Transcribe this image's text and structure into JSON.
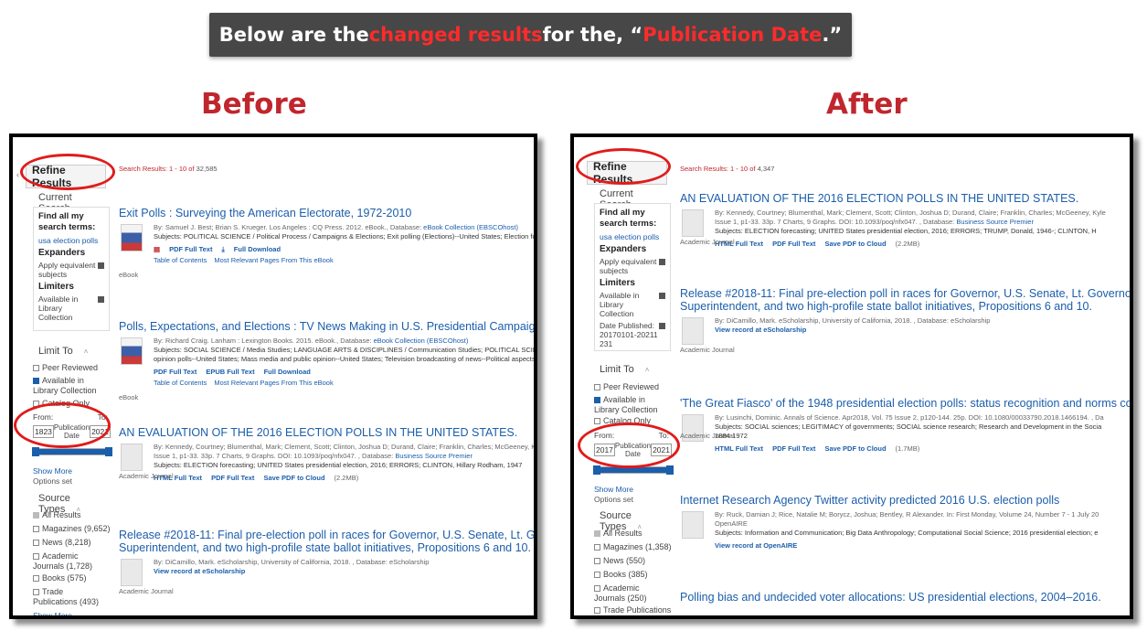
{
  "banner": {
    "pre": "Below are the ",
    "red1": "changed results",
    "mid": " for the, “",
    "red2": "Publication Date",
    "post": ".”"
  },
  "headings": {
    "before": "Before",
    "after": "After"
  },
  "sidebar_common": {
    "refine": "Refine Results",
    "current_search": "Current Search",
    "find_all": "Find all my search terms:",
    "query": "usa election polls",
    "expanders": "Expanders",
    "apply_equiv": "Apply equivalent subjects",
    "limiters": "Limiters",
    "available": "Available in Library Collection",
    "limit_to": "Limit To",
    "peer": "Peer Reviewed",
    "avail_lib": "Available in Library Collection",
    "catalog": "Catalog Only",
    "from": "From:",
    "to": "To:",
    "pub_date": "Publication Date",
    "show_more": "Show More",
    "options_set": "Options set",
    "source_types": "Source Types"
  },
  "before": {
    "count_prefix": "Search Results: 1 - 10 of ",
    "count_total": "32,585",
    "from_year": "1823",
    "to_year": "2021",
    "slider_fill": 1.0,
    "sources": [
      "All Results",
      "Magazines (9,652)",
      "News (8,218)",
      "Academic Journals (1,728)",
      "Books (575)",
      "Trade Publications (493)"
    ],
    "show_more2": "Show More",
    "results": [
      {
        "num": "1.",
        "title": "Exit Polls : Surveying the American Electorate, 1972-2010",
        "meta": "By: Samuel J. Best; Brian S. Krueger. Los Angeles : CQ Press. 2012. eBook., Database: ",
        "db": "eBook Collection (EBSCOhost)",
        "subjects": "Subjects: POLITICAL SCIENCE / Political Process / Campaigns & Elections; Exit polling (Elections)--United States; Election forecasting--United",
        "type": "eBook",
        "a1": "PDF Full Text",
        "a2": "Full Download",
        "l1": "Table of Contents",
        "l2": "Most Relevant Pages From This eBook"
      },
      {
        "num": "2.",
        "title": "Polls, Expectations, and Elections : TV News Making in U.S. Presidential Campaigns",
        "meta": "By: Richard Craig. Lanham : Lexington Books. 2015. eBook., Database: ",
        "db": "eBook Collection (EBSCOhost)",
        "subjects": "Subjects: SOCIAL SCIENCE / Media Studies; LANGUAGE ARTS & DISCIPLINES / Communication Studies; POLITICAL SCIENCE / American Gov",
        "subjects2": "opinion polls--United States; Mass media and public opinion--United States; Television broadcasting of news--Political aspects--United States; Te",
        "type": "eBook",
        "a1": "PDF Full Text",
        "a2": "EPUB Full Text",
        "a3": "Full Download",
        "l1": "Table of Contents",
        "l2": "Most Relevant Pages From This eBook"
      },
      {
        "num": "3.",
        "title": "AN EVALUATION OF THE 2016 ELECTION POLLS IN THE UNITED STATES.",
        "meta": "By: Kennedy, Courtney; Blumenthal, Mark; Clement, Scott; Clinton, Joshua D; Durand, Claire; Franklin, Charles; McGeeney, Kyley; Miringoff, Lee; C",
        "meta2": "Issue 1, p1-33. 33p. 7 Charts, 9 Graphs. DOI: 10.1093/poq/nfx047. , Database: ",
        "db": "Business Source Premier",
        "subjects": "Subjects: ELECTION forecasting; UNITED States presidential election, 2016; ERRORS; CLINTON, Hillary Rodham, 1947",
        "type": "Academic Journal",
        "a1": "HTML Full Text",
        "a2": "PDF Full Text",
        "a3": "Save PDF to Cloud",
        "size": "(2.2MB)"
      },
      {
        "num": "4.",
        "title": "Release #2018-11: Final pre-election poll in races for Governor, U.S. Senate, Lt. Governor, Insurance C",
        "title2": "Superintendent, and two high-profile state ballot initiatives, Propositions 6 and 10.",
        "meta": "By: DiCamillo, Mark. eScholarship, University of California, 2018. , Database: eScholarship",
        "link": "View record at eScholarship",
        "type": "Academic Journal"
      }
    ]
  },
  "after": {
    "count_prefix": "Search Results: 1 - 10 of ",
    "count_total": "4,347",
    "date_published": "Date Published:",
    "date_range": "20170101-20211231",
    "from_year": "2017",
    "to_year": "2021",
    "slider_fill": 1.0,
    "sources": [
      "All Results",
      "Magazines (1,358)",
      "News (550)",
      "Books (385)",
      "Academic Journals (250)",
      "Trade Publications"
    ],
    "results": [
      {
        "num": "1.",
        "title": "AN EVALUATION OF THE 2016 ELECTION POLLS IN THE UNITED STATES.",
        "meta": "By: Kennedy, Courtney; Blumenthal, Mark; Clement, Scott; Clinton, Joshua D; Durand, Claire; Franklin, Charles; McGeeney, Kyle",
        "meta2": "Issue 1, p1-33. 33p. 7 Charts, 9 Graphs. DOI: 10.1093/poq/nfx047. , Database: ",
        "db": "Business Source Premier",
        "subjects": "Subjects: ELECTION forecasting; UNITED States presidential election, 2016; ERRORS; TRUMP, Donald, 1946-; CLINTON, H",
        "type": "Academic Journal",
        "a1": "HTML Full Text",
        "a2": "PDF Full Text",
        "a3": "Save PDF to Cloud",
        "size": "(2.2MB)"
      },
      {
        "num": "2.",
        "title": "Release #2018-11: Final pre-election poll in races for Governor, U.S. Senate, Lt. Governor",
        "title2": "Superintendent, and two high-profile state ballot initiatives, Propositions 6 and 10.",
        "meta": "By: DiCamillo, Mark. eScholarship, University of California, 2018. , Database: eScholarship",
        "link": "View record at eScholarship",
        "type": "Academic Journal"
      },
      {
        "num": "3.",
        "title": "'The Great Fiasco' of the 1948 presidential election polls: status recognition and norms co",
        "meta": "By: Lusinchi, Dominic. Annals of Science. Apr2018, Vol. 75 Issue 2, p120-144. 25p. DOI: 10.1080/00033790.2018.1466194. , Da",
        "subjects": "Subjects: SOCIAL sciences; LEGITIMACY of governments; SOCIAL science research; Research and Development in the Socia",
        "subjects2": "1884-1972",
        "type": "Academic Journal",
        "a1": "HTML Full Text",
        "a2": "PDF Full Text",
        "a3": "Save PDF to Cloud",
        "size": "(1.7MB)"
      },
      {
        "num": "4.",
        "title": "Internet Research Agency Twitter activity predicted 2016 U.S. election polls",
        "meta": "By: Ruck, Damian J; Rice, Natalie M; Borycz, Joshua; Bentley, R Alexander. In: First Monday, Volume 24, Number 7 - 1 July 20",
        "meta2": "OpenAIRE",
        "subjects": "Subjects: Information and Communication; Big Data Anthropology; Computational Social Science; 2016 presidential election; e",
        "link": "View record at OpenAIRE"
      },
      {
        "num": "5.",
        "title": "Polling bias and undecided voter allocations: US presidential elections, 2004–2016."
      }
    ]
  }
}
